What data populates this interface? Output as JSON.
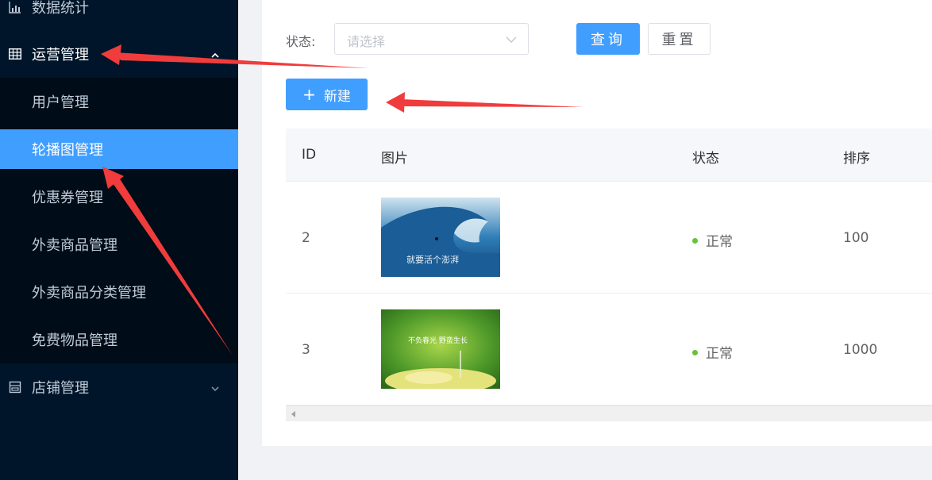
{
  "sidebar": {
    "stats_label": "数据统计",
    "ops_label": "运营管理",
    "sub_items": [
      "用户管理",
      "轮播图管理",
      "优惠券管理",
      "外卖商品管理",
      "外卖商品分类管理",
      "免费物品管理"
    ],
    "shop_label": "店铺管理",
    "active_sub_index": 1
  },
  "filter": {
    "status_label": "状态:",
    "status_placeholder": "请选择",
    "query_label": "查询",
    "reset_label": "重置"
  },
  "toolbar": {
    "new_label": "新建"
  },
  "table": {
    "headers": [
      "ID",
      "图片",
      "状态",
      "排序"
    ],
    "rows": [
      {
        "id": "2",
        "image_text": "就要活个澎湃",
        "status": "正常",
        "sort": "100"
      },
      {
        "id": "3",
        "image_text": "不负春光 野蛮生长",
        "status": "正常",
        "sort": "1000"
      }
    ]
  },
  "colors": {
    "sidebar_bg": "#001529",
    "submenu_bg": "#000c17",
    "accent": "#409eff",
    "status_ok": "#67c23a",
    "annotation_arrow": "#f03c3c"
  },
  "icons": [
    "bar-chart-icon",
    "grid-icon",
    "chevron-up-icon",
    "shop-icon",
    "chevron-down-icon",
    "dropdown-arrow-icon",
    "plus-icon"
  ]
}
